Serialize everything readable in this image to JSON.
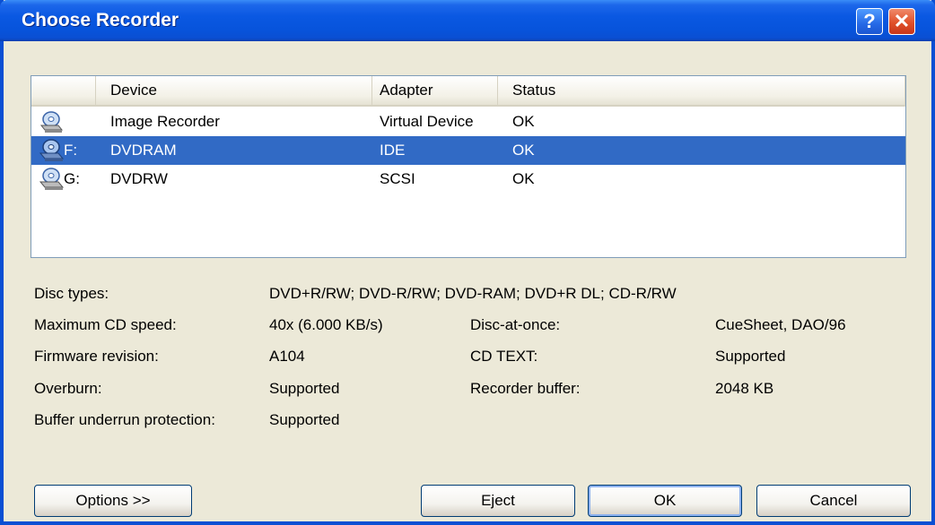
{
  "window": {
    "title": "Choose Recorder",
    "help_glyph": "?",
    "close_glyph": "✕",
    "title_bar_color": "#0a58e2",
    "close_button_color": "#e0502a"
  },
  "list": {
    "columns": [
      "Device",
      "Adapter",
      "Status"
    ],
    "rows": [
      {
        "icon": "image-recorder-icon",
        "letter": "",
        "device": "Image Recorder",
        "adapter": "Virtual Device",
        "status": "OK",
        "selected": false
      },
      {
        "icon": "dvd-drive-icon",
        "letter": "F:",
        "device": "DVDRAM",
        "adapter": "IDE",
        "status": "OK",
        "selected": true
      },
      {
        "icon": "dvd-drive-icon",
        "letter": "G:",
        "device": "DVDRW",
        "adapter": "SCSI",
        "status": "OK",
        "selected": false
      }
    ],
    "selection_color": "#316ac5"
  },
  "info": {
    "disc_types_label": "Disc types:",
    "disc_types_value": "DVD+R/RW; DVD-R/RW; DVD-RAM; DVD+R DL; CD-R/RW",
    "max_speed_label": "Maximum CD speed:",
    "max_speed_value": "40x (6.000 KB/s)",
    "firmware_label": "Firmware revision:",
    "firmware_value": "A104",
    "overburn_label": "Overburn:",
    "overburn_value": "Supported",
    "underrun_label": "Buffer underrun protection:",
    "underrun_value": "Supported",
    "dao_label": "Disc-at-once:",
    "dao_value": "CueSheet, DAO/96",
    "cdtext_label": "CD TEXT:",
    "cdtext_value": "Supported",
    "buffer_label": "Recorder buffer:",
    "buffer_value": "2048 KB"
  },
  "buttons": {
    "options": "Options >>",
    "eject": "Eject",
    "ok": "OK",
    "cancel": "Cancel"
  }
}
